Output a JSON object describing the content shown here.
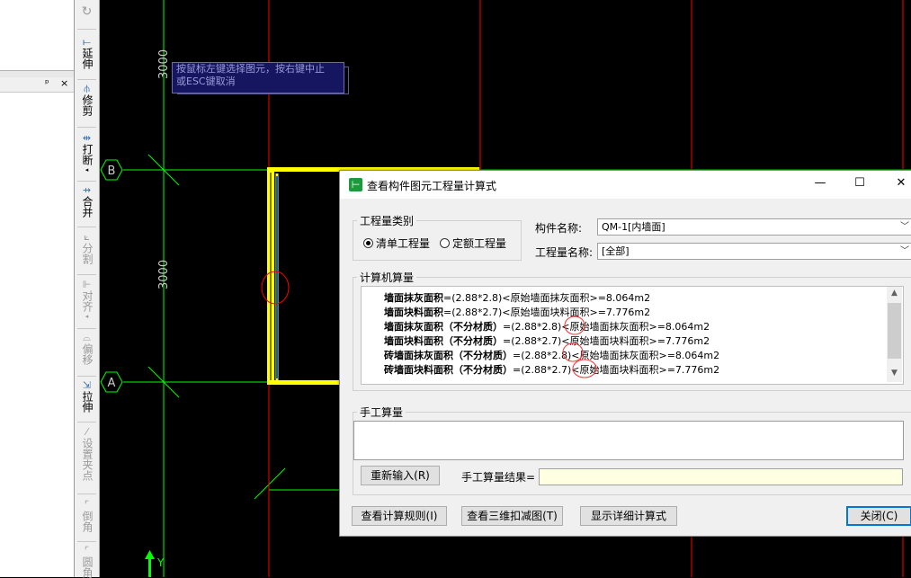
{
  "toolbar": {
    "items": [
      {
        "label": "延伸",
        "icon": "⟝"
      },
      {
        "label": "修剪",
        "icon": "⫛"
      },
      {
        "label": "打断",
        "icon": "⇹"
      },
      {
        "label": "合并",
        "icon": "⇸"
      },
      {
        "label": "分割",
        "icon": "⟀"
      },
      {
        "label": "对齐",
        "icon": "⊩"
      },
      {
        "label": "偏移",
        "icon": "⌓"
      },
      {
        "label": "拉伸",
        "icon": "⇲"
      },
      {
        "label": "设置夹点",
        "icon": "⁄"
      },
      {
        "label": "倒角",
        "icon": "⌜"
      },
      {
        "label": "圆角",
        "icon": "⌜"
      }
    ]
  },
  "left_panel": {
    "pin": "ᵖ",
    "close": "×"
  },
  "canvas": {
    "tooltip_line1": "按鼠标左键选择图元，按右键中止",
    "tooltip_line2": "或ESC键取消",
    "dim_top": "3000",
    "dim_mid": "3000",
    "axis_b": "B",
    "axis_a": "A",
    "y_axis": "Y",
    "colors": {
      "grid": "#00ff00",
      "red_line": "#ff0000",
      "wall_yellow": "#ffff00",
      "wall_blue": "#0060ff"
    }
  },
  "dialog": {
    "title": "查看构件图元工程量计算式",
    "app_icon": "⊢",
    "minimize": "—",
    "maximize": "☐",
    "close": "✕",
    "qty_type_legend": "工程量类别",
    "radio_list": "清单工程量",
    "radio_quota": "定额工程量",
    "component_name_label": "构件名称:",
    "component_name_value": "QM-1[内墙面]",
    "qty_name_label": "工程量名称:",
    "qty_name_value": "[全部]",
    "computer_calc_legend": "计算机算量",
    "formulas": [
      {
        "name": "墙面抹灰面积",
        "expr": "=(2.88*2.8)<原始墙面抹灰面积>=8.064m2"
      },
      {
        "name": "墙面块料面积",
        "expr": "=(2.88*2.7)<原始墙面块料面积>=7.776m2"
      },
      {
        "name": "墙面抹灰面积（不分材质）",
        "expr": "=(2.88*2.8)<原始墙面抹灰面积>=8.064m2"
      },
      {
        "name": "墙面块料面积（不分材质）",
        "expr": "=(2.88*2.7)<原始墙面块料面积>=7.776m2"
      },
      {
        "name": "砖墙面抹灰面积（不分材质）",
        "expr": "=(2.88*2.8)<原始墙面抹灰面积>=8.064m2"
      },
      {
        "name": "砖墙面块料面积（不分材质）",
        "expr": "=(2.88*2.7)<原始墙面块料面积>=7.776m2"
      }
    ],
    "manual_calc_legend": "手工算量",
    "reinput_button": "重新输入(R)",
    "manual_result_label": "手工算量结果=",
    "view_rules_button": "查看计算规则(I)",
    "view_3d_button": "查看三维扣减图(T)",
    "show_detail_button": "显示详细计算式",
    "close_button": "关闭(C)"
  }
}
